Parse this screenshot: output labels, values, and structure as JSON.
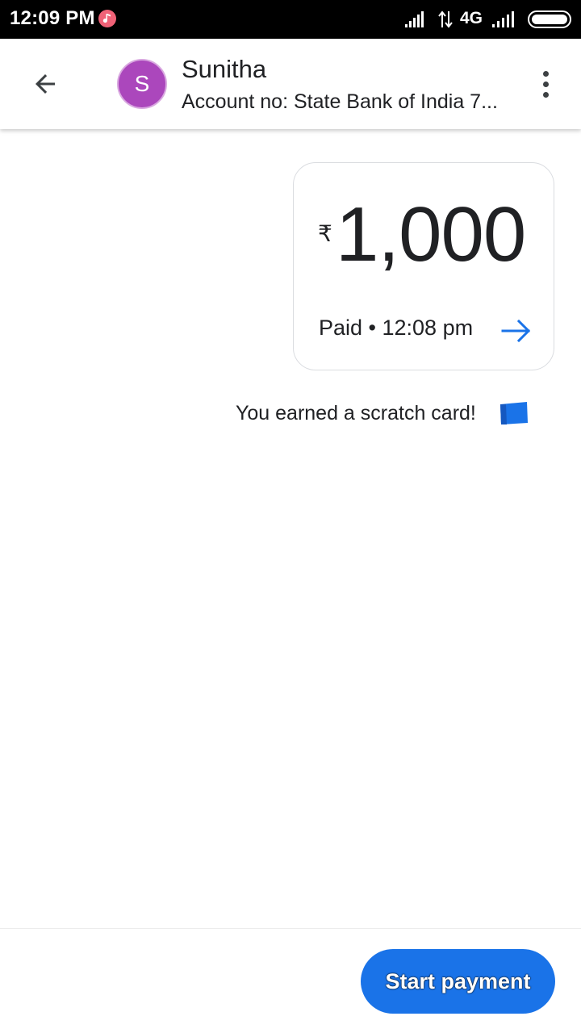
{
  "status_bar": {
    "time": "12:09 PM",
    "network_type": "4G",
    "icons": [
      "music-notification-icon",
      "signal-icon",
      "data-arrows-icon",
      "signal-icon",
      "battery-icon"
    ]
  },
  "header": {
    "back_icon": "arrow-left-icon",
    "avatar_initial": "S",
    "contact_name": "Sunitha",
    "account_text": "Account no: State Bank of India 7...",
    "more_icon": "more-vertical-icon"
  },
  "payment": {
    "currency_symbol": "₹",
    "amount": "1,000",
    "status": "Paid • 12:08 pm",
    "arrow_icon": "arrow-right-icon"
  },
  "reward": {
    "text": "You earned a scratch card!",
    "icon": "scratch-card-icon"
  },
  "footer": {
    "start_payment_label": "Start payment"
  },
  "colors": {
    "accent": "#1a73e8",
    "avatar": "#ab47bc",
    "status_bar": "#000000",
    "music_icon": "#f06277"
  }
}
